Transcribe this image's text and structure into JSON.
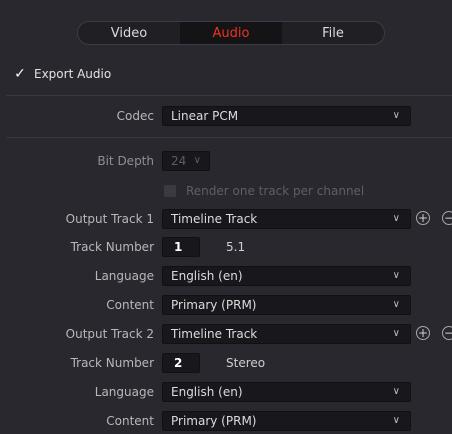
{
  "tabs": [
    {
      "label": "Video"
    },
    {
      "label": "Audio"
    },
    {
      "label": "File"
    }
  ],
  "export_audio": {
    "checked": true,
    "label": "Export Audio"
  },
  "codec": {
    "label": "Codec",
    "value": "Linear PCM"
  },
  "bit_depth": {
    "label": "Bit Depth",
    "value": "24"
  },
  "render_per_channel": {
    "label": "Render one track per channel",
    "checked": false
  },
  "tracks": [
    {
      "output_label": "Output Track 1",
      "output_value": "Timeline Track",
      "number_label": "Track Number",
      "number": "1",
      "format": "5.1",
      "language_label": "Language",
      "language": "English (en)",
      "content_label": "Content",
      "content": "Primary (PRM)"
    },
    {
      "output_label": "Output Track 2",
      "output_value": "Timeline Track",
      "number_label": "Track Number",
      "number": "2",
      "format": "Stereo",
      "language_label": "Language",
      "language": "English (en)",
      "content_label": "Content",
      "content": "Primary (PRM)"
    }
  ],
  "colors": {
    "background": "#28282e",
    "field": "#18181c",
    "active_tab_text": "#ee3322"
  }
}
